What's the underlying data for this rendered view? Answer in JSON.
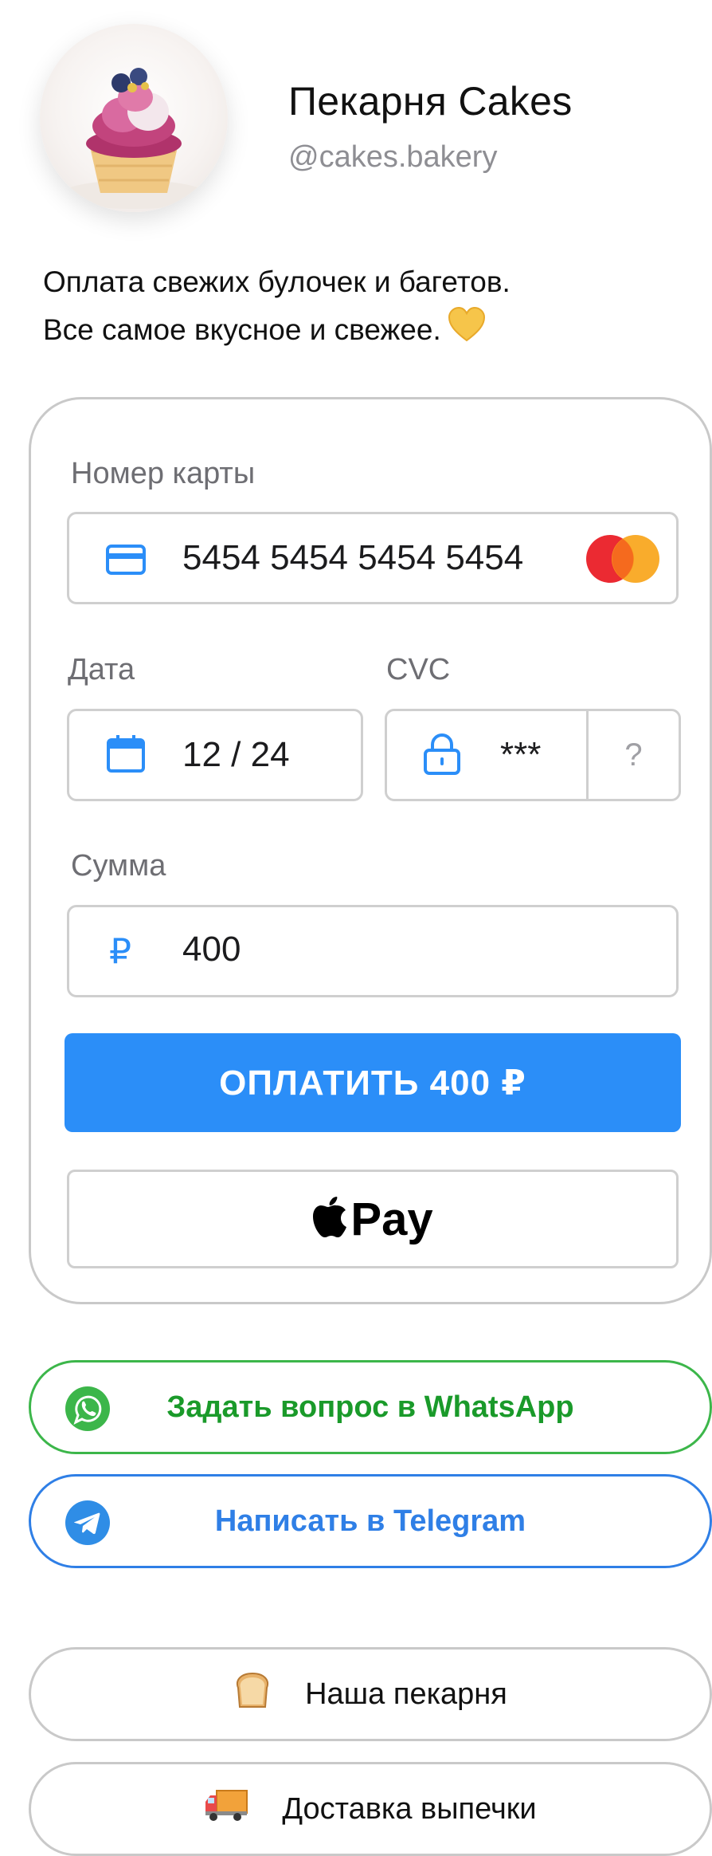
{
  "profile": {
    "name": "Пекарня Cakes",
    "handle": "@cakes.bakery",
    "description_line1": "Оплата свежих булочек и багетов.",
    "description_line2": "Все самое вкусное и свежее."
  },
  "payment": {
    "card_label": "Номер карты",
    "card_number": "5454 5454 5454 5454",
    "date_label": "Дата",
    "date_value": "12 / 24",
    "cvc_label": "CVC",
    "cvc_value": "***",
    "cvc_help": "?",
    "amount_label": "Сумма",
    "currency_symbol": "₽",
    "amount_value": "400",
    "pay_button": "ОПЛАТИТЬ 400 ₽",
    "apple_pay_text": "Pay"
  },
  "contacts": {
    "whatsapp": "Задать вопрос в WhatsApp",
    "telegram": "Написать в Telegram"
  },
  "links": {
    "bakery": "Наша пекарня",
    "delivery": "Доставка выпечки"
  },
  "colors": {
    "accent": "#2b8ef8",
    "whatsapp": "#3cb64a",
    "telegram": "#2f7fe6",
    "icon_blue": "#2b8ef8"
  },
  "icons": {
    "avatar": "cupcake-photo",
    "heart": "yellow-heart-icon",
    "card": "credit-card-icon",
    "card_brand": "mastercard-icon",
    "date": "calendar-icon",
    "cvc": "lock-icon",
    "amount": "ruble-icon",
    "apple": "apple-icon",
    "whatsapp": "whatsapp-icon",
    "telegram": "telegram-icon",
    "bakery": "bread-icon",
    "delivery": "delivery-truck-icon"
  }
}
